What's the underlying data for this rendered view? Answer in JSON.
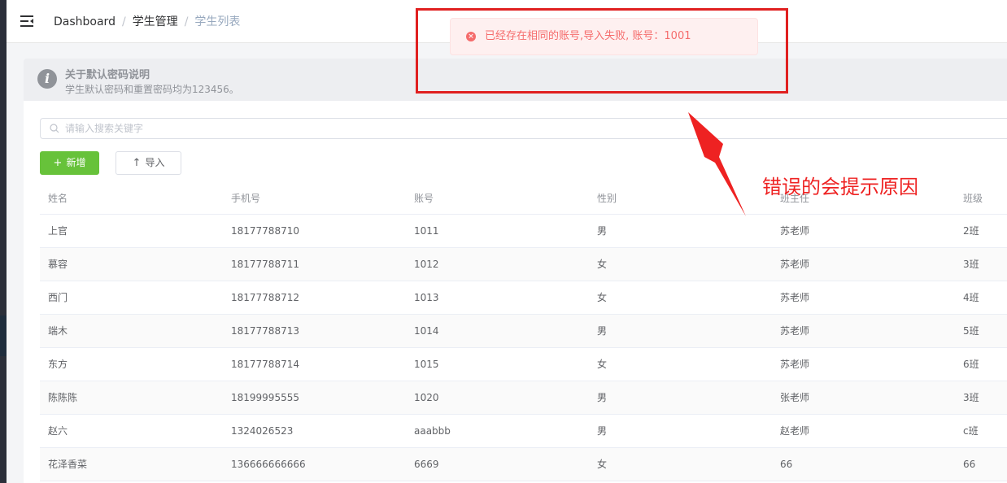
{
  "breadcrumb": {
    "items": [
      "Dashboard",
      "学生管理",
      "学生列表"
    ],
    "separator": "/"
  },
  "info_alert": {
    "title": "关于默认密码说明",
    "description": "学生默认密码和重置密码均为123456。",
    "icon": "info-icon"
  },
  "search": {
    "placeholder": "请输入搜索关键字",
    "value": ""
  },
  "toolbar": {
    "add_label": "新增",
    "import_label": "导入"
  },
  "table": {
    "headers": [
      "姓名",
      "手机号",
      "账号",
      "性别",
      "班主任",
      "班级"
    ],
    "rows": [
      [
        "上官",
        "18177788710",
        "1011",
        "男",
        "苏老师",
        "2班"
      ],
      [
        "慕容",
        "18177788711",
        "1012",
        "女",
        "苏老师",
        "3班"
      ],
      [
        "西门",
        "18177788712",
        "1013",
        "女",
        "苏老师",
        "4班"
      ],
      [
        "端木",
        "18177788713",
        "1014",
        "男",
        "苏老师",
        "5班"
      ],
      [
        "东方",
        "18177788714",
        "1015",
        "女",
        "苏老师",
        "6班"
      ],
      [
        "陈陈陈",
        "18199995555",
        "1020",
        "男",
        "张老师",
        "3班"
      ],
      [
        "赵六",
        "1324026523",
        "aaabbb",
        "男",
        "赵老师",
        "c班"
      ],
      [
        "花泽香菜",
        "136666666666",
        "6669",
        "女",
        "66",
        "66"
      ]
    ]
  },
  "toast": {
    "type": "error",
    "message": "已经存在相同的账号,导入失败, 账号：1001"
  },
  "annotation": {
    "text": "错误的会提示原因",
    "color": "#ee2222"
  },
  "colors": {
    "success": "#67c23a",
    "error": "#f56c6c",
    "info": "#909399"
  }
}
